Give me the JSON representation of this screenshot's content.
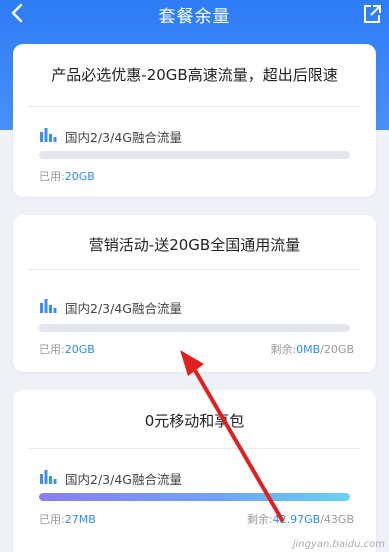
{
  "header": {
    "title": "套餐余量",
    "accent_color": "#2d7cf6",
    "back_icon": "chevron-left-icon",
    "share_icon": "share-icon"
  },
  "cards": [
    {
      "title": "产品必选优惠-20GB高速流量，超出后限速",
      "row_label": "国内2/3/4G融合流量",
      "used_label": "已用:",
      "used_value": "20GB",
      "remain_label": "",
      "remain_value": "",
      "remain_total": "",
      "progress": 0
    },
    {
      "title": "营销活动-送20GB全国通用流量",
      "row_label": "国内2/3/4G融合流量",
      "used_label": "已用:",
      "used_value": "20GB",
      "remain_label": "剩余:",
      "remain_value": "0MB",
      "remain_total": "/20GB",
      "progress": 0
    },
    {
      "title": "0元移动和享包",
      "row_label": "国内2/3/4G融合流量",
      "used_label": "已用:",
      "used_value": "27MB",
      "remain_label": "剩余:",
      "remain_value": "42.97GB",
      "remain_total": "/43GB",
      "progress": 0.999
    }
  ],
  "watermark": "jingyan.baidu.com"
}
